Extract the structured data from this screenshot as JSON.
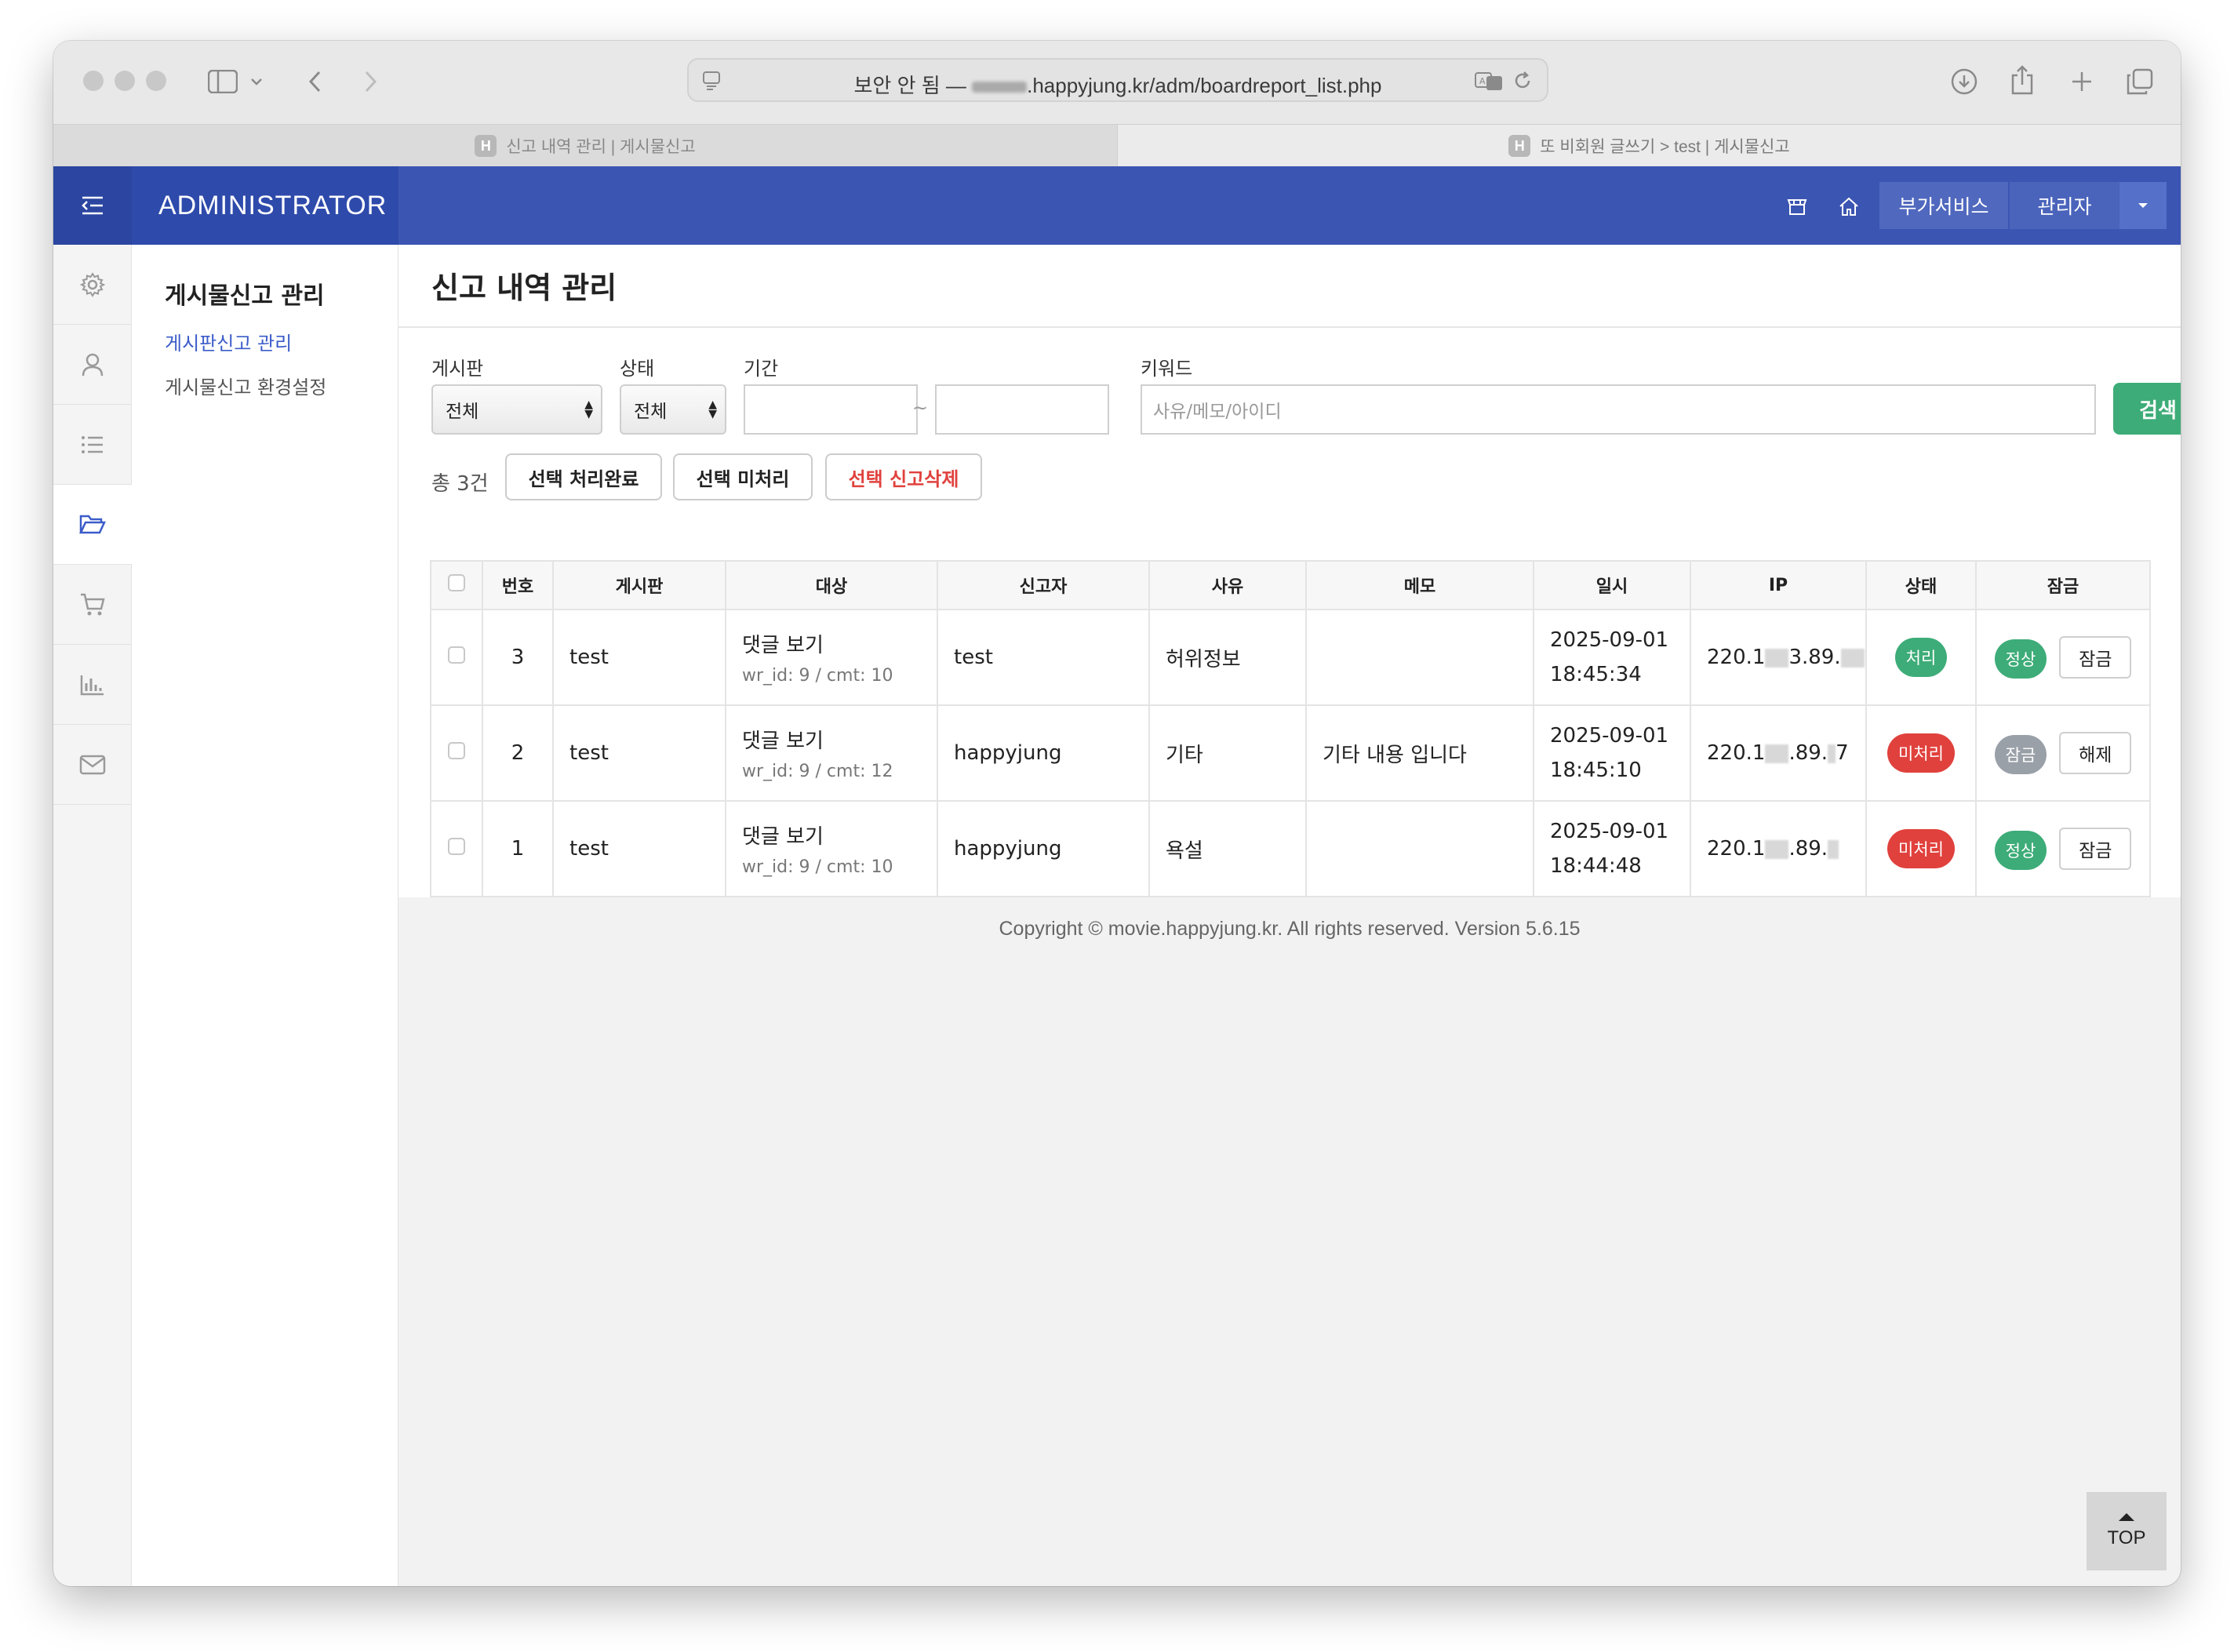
{
  "browser": {
    "url": "보안 안 됨 — ",
    "url_domain": ".happyjung.kr/adm/boardreport_list.php",
    "tabs": [
      {
        "label": "신고 내역 관리 | 게시물신고",
        "favicon": "H"
      },
      {
        "label": "또 비회원 글쓰기 > test | 게시물신고",
        "favicon": "H"
      }
    ]
  },
  "header": {
    "brand": "ADMINISTRATOR",
    "addon_label": "부가서비스",
    "admin_label": "관리자",
    "accent_color": "#3b55b2"
  },
  "rail": {
    "icons": [
      "gear-icon",
      "user-icon",
      "list-icon",
      "folder-icon",
      "cart-icon",
      "chart-icon",
      "mail-icon"
    ]
  },
  "submenu": {
    "title": "게시물신고 관리",
    "items": [
      {
        "label": "게시판신고 관리",
        "active": true
      },
      {
        "label": "게시물신고 환경설정",
        "active": false
      }
    ]
  },
  "page": {
    "title": "신고 내역 관리"
  },
  "filters": {
    "board_label": "게시판",
    "board_value": "전체",
    "status_label": "상태",
    "status_value": "전체",
    "period_label": "기간",
    "period_sep": "~",
    "keyword_label": "키워드",
    "keyword_placeholder": "사유/메모/아이디",
    "search_label": "검색"
  },
  "actions": {
    "total": "총 3건",
    "complete": "선택 처리완료",
    "pending": "선택 미처리",
    "delete": "선택 신고삭제"
  },
  "table": {
    "headers": [
      "번호",
      "게시판",
      "대상",
      "신고자",
      "사유",
      "메모",
      "일시",
      "IP",
      "상태",
      "잠금"
    ],
    "rows": [
      {
        "no": "3",
        "board": "test",
        "target": "댓글 보기",
        "target_meta": "wr_id: 9 / cmt: 10",
        "reporter": "test",
        "reason": "허위정보",
        "memo": "",
        "date": "2025-09-01",
        "time": "18:45:34",
        "ip_a": "220.1",
        "ip_b": "3.89.",
        "ip_c": "",
        "status": "처리",
        "status_color": "#3dac78",
        "lock": "정상",
        "lock_color": "#3dac78",
        "lock_btn": "잠금"
      },
      {
        "no": "2",
        "board": "test",
        "target": "댓글 보기",
        "target_meta": "wr_id: 9 / cmt: 12",
        "reporter": "happyjung",
        "reason": "기타",
        "memo": "기타 내용 입니다",
        "date": "2025-09-01",
        "time": "18:45:10",
        "ip_a": "220.1",
        "ip_b": ".89.",
        "ip_c": "7",
        "status": "미처리",
        "status_color": "#e0413d",
        "lock": "잠금",
        "lock_color": "#9aa0a8",
        "lock_btn": "해제"
      },
      {
        "no": "1",
        "board": "test",
        "target": "댓글 보기",
        "target_meta": "wr_id: 9 / cmt: 10",
        "reporter": "happyjung",
        "reason": "욕설",
        "memo": "",
        "date": "2025-09-01",
        "time": "18:44:48",
        "ip_a": "220.1",
        "ip_b": ".89.",
        "ip_c": "",
        "status": "미처리",
        "status_color": "#e0413d",
        "lock": "정상",
        "lock_color": "#3dac78",
        "lock_btn": "잠금"
      }
    ]
  },
  "footer": {
    "copyright": "Copyright © movie.happyjung.kr. All rights reserved. Version 5.6.15",
    "top_label": "TOP"
  }
}
